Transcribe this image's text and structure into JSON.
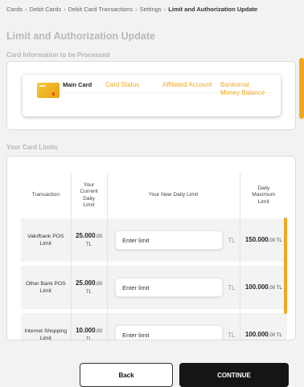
{
  "breadcrumb": {
    "items": [
      "Cards",
      "Debit Cards",
      "Debit Card Transactions",
      "Settings"
    ],
    "current": "Limit and Authorization Update",
    "separator": "›"
  },
  "page_title": "Limit and Authorization Update",
  "card_info": {
    "section_label": "Card Information to be Processed",
    "card_name": "Main Card",
    "headers": [
      "Card Status",
      "Affiliated Account",
      "Bankomat Money Balance"
    ]
  },
  "limits": {
    "section_label": "Your Card Limits",
    "columns": [
      "Transaction",
      "Your Current Daily Limit",
      "Your New Daily Limit",
      "Daily Maximum Limit"
    ],
    "rows": [
      {
        "transaction": "Vakıfbank POS Limit",
        "current_int": "25.000",
        "current_dec": ",00",
        "currency": "TL",
        "placeholder": "Enter limit",
        "max_int": "150.000",
        "max_dec": ",00 TL"
      },
      {
        "transaction": "Other Bank POS Limit",
        "current_int": "25.000",
        "current_dec": ",00",
        "currency": "TL",
        "placeholder": "Enter limit",
        "max_int": "100.000",
        "max_dec": ",00 TL"
      },
      {
        "transaction": "Internet Shopping Limit",
        "current_int": "10.000",
        "current_dec": ",00",
        "currency": "TL",
        "placeholder": "Enter limit",
        "max_int": "100.000",
        "max_dec": ",00 TL"
      }
    ]
  },
  "buttons": {
    "back": "Back",
    "continue": "CONTINUE"
  },
  "colors": {
    "accent": "#f2a81d",
    "primary_button": "#151515",
    "background": "#f2f2f2"
  }
}
